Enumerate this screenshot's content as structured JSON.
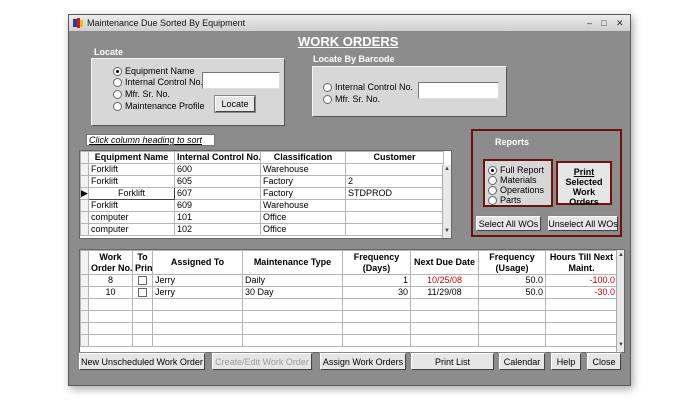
{
  "window": {
    "title": "Maintenance Due Sorted By Equipment"
  },
  "heading": "WORK ORDERS",
  "locate": {
    "label": "Locate",
    "options": [
      "Equipment Name",
      "Internal Control No.",
      "Mfr. Sr. No.",
      "Maintenance Profile"
    ],
    "selected": 0,
    "input_value": "",
    "button": "Locate"
  },
  "barcode": {
    "label": "Locate By Barcode",
    "options": [
      "Internal Control No.",
      "Mfr. Sr. No."
    ],
    "input_value": ""
  },
  "sort_hint": "Click column heading to sort",
  "equipment_table": {
    "headers": [
      "Equipment Name",
      "Internal Control No.",
      "Classification",
      "Customer"
    ],
    "rows": [
      [
        "Forklift",
        "600",
        "Warehouse",
        ""
      ],
      [
        "Forklift",
        "605",
        "Factory",
        "2"
      ],
      [
        "Forklift",
        "607",
        "Factory",
        "STDPROD"
      ],
      [
        "Forklift",
        "609",
        "Warehouse",
        ""
      ],
      [
        "computer",
        "101",
        "Office",
        ""
      ],
      [
        "computer",
        "102",
        "Office",
        ""
      ]
    ],
    "current_row": 2
  },
  "reports": {
    "label": "Reports",
    "options": [
      "Full Report",
      "Materials",
      "Operations",
      "Parts"
    ],
    "selected": 0,
    "print_button": [
      "Print",
      "Selected",
      "Work Orders"
    ],
    "select_all": "Select All WOs",
    "unselect_all": "Unselect All WOs"
  },
  "wo_table": {
    "headers": [
      [
        "Work",
        "Order No."
      ],
      [
        "To",
        "Print"
      ],
      [
        "Assigned To"
      ],
      [
        "Maintenance Type"
      ],
      [
        "Frequency",
        "(Days)"
      ],
      [
        "Next Due Date"
      ],
      [
        "Frequency",
        "(Usage)"
      ],
      [
        "Hours Till Next",
        "Maint."
      ]
    ],
    "rows": [
      {
        "order": "8",
        "assigned": "Jerry",
        "type": "Daily",
        "freq_days": "1",
        "next_due": "10/25/08",
        "freq_usage": "50.0",
        "hours": "-100.0",
        "due_overdue": true
      },
      {
        "order": "10",
        "assigned": "Jerry",
        "type": "30 Day",
        "freq_days": "30",
        "next_due": "11/29/08",
        "freq_usage": "50.0",
        "hours": "-30.0",
        "due_overdue": false
      }
    ]
  },
  "buttons": {
    "new_unscheduled": "New Unscheduled Work Order",
    "create_edit": "Create/Edit Work Order",
    "assign": "Assign Work Orders",
    "print_list": "Print List",
    "calendar": "Calendar",
    "help": "Help",
    "close": "Close"
  },
  "colors": {
    "panel": "#d7d7d7",
    "background": "#8c8c8c",
    "accent": "#6d1111",
    "overdue": "#d10000"
  }
}
